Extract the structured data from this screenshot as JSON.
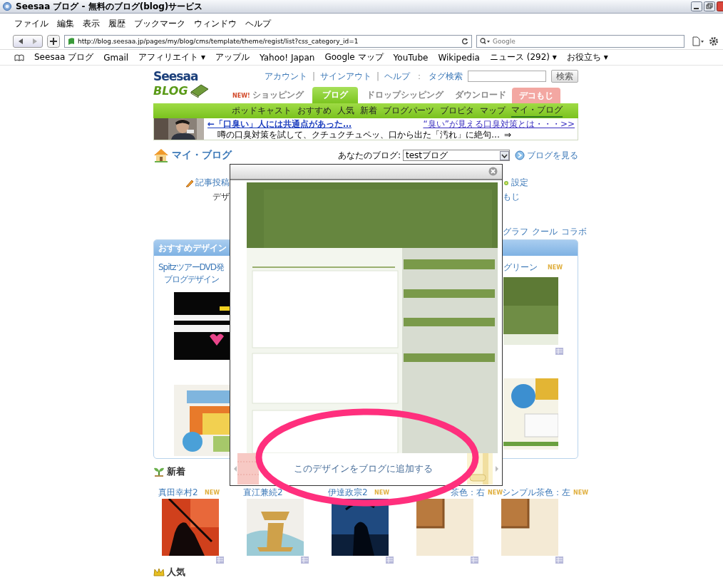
{
  "window": {
    "title": "Seesaa ブログ - 無料のブログ(blog)サービス"
  },
  "menu_bar": [
    "ファイル",
    "編集",
    "表示",
    "履歴",
    "ブックマーク",
    "ウィンドウ",
    "ヘルプ"
  ],
  "toolbar": {
    "url": "http://blog.seesaa.jp/pages/my/blog/cms/template/theme/regist/list?css_category_id=1",
    "search_placeholder": "Google"
  },
  "bookmarks": [
    {
      "label": "Seesaa ブログ"
    },
    {
      "label": "Gmail"
    },
    {
      "label": "アフィリエイト",
      "caret": "▾"
    },
    {
      "label": "アップル"
    },
    {
      "label": "Yahoo! Japan"
    },
    {
      "label": "Google マップ"
    },
    {
      "label": "YouTube"
    },
    {
      "label": "Wikipedia"
    },
    {
      "label": "ニュース (292)",
      "caret": "▾"
    },
    {
      "label": "お役立ち",
      "caret": "▾"
    }
  ],
  "header": {
    "logo_top": "Seesaa",
    "logo_bottom": "BLOG",
    "top_links": [
      {
        "kind": "link",
        "text": "アカウント"
      },
      {
        "kind": "sep",
        "text": "|"
      },
      {
        "kind": "link",
        "text": "サインアウト"
      },
      {
        "kind": "sep",
        "text": "|"
      },
      {
        "kind": "link",
        "text": "ヘルプ"
      },
      {
        "kind": "sep",
        "text": "："
      },
      {
        "kind": "link",
        "text": "タグ検索"
      }
    ],
    "search_button": "検索"
  },
  "tabs": [
    {
      "badge": "NEW!",
      "label": "ショッピング",
      "kind": "normal",
      "selected": false
    },
    {
      "label": "ブログ",
      "kind": "normal",
      "selected": true
    },
    {
      "label": "ドロップシッピング",
      "kind": "normal",
      "selected": false
    },
    {
      "label": "ダウンロード",
      "kind": "normal",
      "selected": false
    },
    {
      "label": "デコもじ",
      "kind": "special",
      "selected": false
    }
  ],
  "subnav": [
    {
      "label": "ポッドキャスト",
      "selected": false
    },
    {
      "label": "おすすめ",
      "selected": false
    },
    {
      "label": "人気",
      "selected": false
    },
    {
      "label": "新着",
      "selected": false
    },
    {
      "label": "ブログパーツ",
      "selected": false
    },
    {
      "label": "ブロピタ",
      "selected": false
    },
    {
      "label": "マップ",
      "selected": false
    },
    {
      "label": "マイ・ブログ",
      "selected": true
    }
  ],
  "ad": {
    "headline": "←「口臭い」人には共通点があった…",
    "text": "噂の口臭対策を試して、クチュクチュペッ、口から出た「汚れ」に絶句…",
    "arrow": "⇒",
    "link": "“臭い”が見える口臭対策とは・・・>>"
  },
  "my_blog": {
    "title": "マイ・ブログ",
    "blog_label": "あなたのブログ:",
    "blog_value": "testブログ",
    "view_link": "ブログを見る"
  },
  "behind_modal": {
    "left_tab": "記事投稿",
    "left_sub": "デザ",
    "right_tab": "設定",
    "right_sub": "もじ",
    "categories": [
      "グラフ",
      "クール",
      "コラボ"
    ]
  },
  "recommended": {
    "title": "おすすめデザイン",
    "left_caption": [
      "SpitzツアーDVD発",
      "ブログデザイン"
    ],
    "right_title": "グリーン",
    "right_badge": "NEW"
  },
  "modal": {
    "button": "このデザインをブログに追加する"
  },
  "new_section": {
    "title": "新着",
    "items": [
      {
        "title": "真田幸村2",
        "badge": "NEW"
      },
      {
        "title": "直江兼続2"
      },
      {
        "title": "伊達政宗2",
        "badge": "NEW"
      },
      {
        "title": "茶色：右",
        "badge": "NEW"
      },
      {
        "title": "シンプル茶色：左",
        "badge": "NEW"
      }
    ]
  },
  "popular": {
    "title": "人気"
  }
}
